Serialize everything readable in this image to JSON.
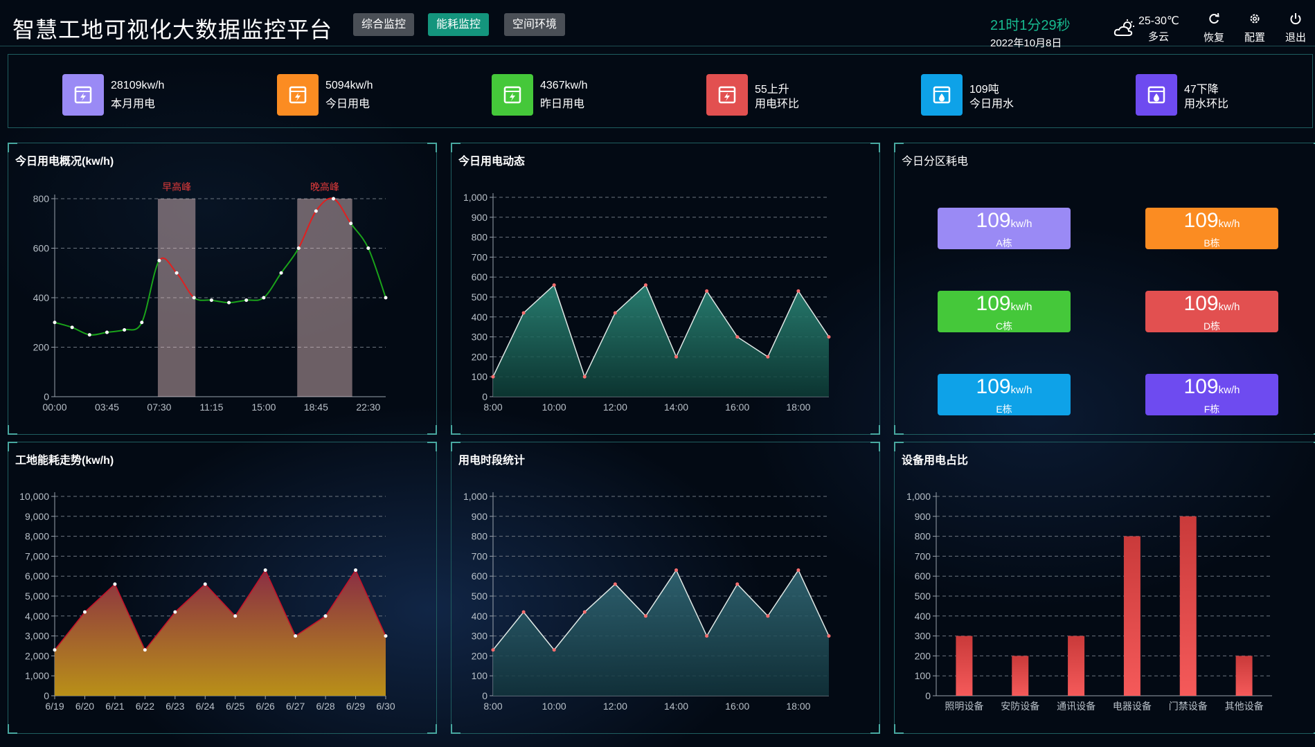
{
  "header": {
    "title": "智慧工地可视化大数据监控平台",
    "tabs": [
      {
        "label": "综合监控",
        "active": false
      },
      {
        "label": "能耗监控",
        "active": true
      },
      {
        "label": "空间环境",
        "active": false
      }
    ],
    "time": "21时1分29秒",
    "date": "2022年10月8日",
    "weather_temp": "25-30℃",
    "weather_cond": "多云",
    "actions": {
      "restore": "恢复",
      "settings": "配置",
      "logout": "退出"
    }
  },
  "stats": [
    {
      "value": "28109kw/h",
      "label": "本月用电",
      "color": "#9a8af5",
      "icon": "electric-meter-icon"
    },
    {
      "value": "5094kw/h",
      "label": "今日用电",
      "color": "#fb8c22",
      "icon": "electric-meter-icon"
    },
    {
      "value": "4367kw/h",
      "label": "昨日用电",
      "color": "#45c83a",
      "icon": "electric-meter-icon"
    },
    {
      "value": "55上升",
      "label": "用电环比",
      "color": "#e25050",
      "icon": "electric-meter-icon"
    },
    {
      "value": "109吨",
      "label": "今日用水",
      "color": "#0ea2e8",
      "icon": "water-meter-icon"
    },
    {
      "value": "47下降",
      "label": "用水环比",
      "color": "#6e4bf0",
      "icon": "water-meter-icon"
    }
  ],
  "panels": {
    "p1": "今日用电概况(kw/h)",
    "p2": "今日用电动态",
    "p3": "今日分区耗电",
    "p4": "工地能耗走势(kw/h)",
    "p5": "用电时段统计",
    "p6": "设备用电占比"
  },
  "zones": [
    {
      "value": "109",
      "unit": "kw/h",
      "name": "A栋",
      "color": "#9a8af5"
    },
    {
      "value": "109",
      "unit": "kw/h",
      "name": "B栋",
      "color": "#fb8c22"
    },
    {
      "value": "109",
      "unit": "kw/h",
      "name": "C栋",
      "color": "#45c83a"
    },
    {
      "value": "109",
      "unit": "kw/h",
      "name": "D栋",
      "color": "#e25050"
    },
    {
      "value": "109",
      "unit": "kw/h",
      "name": "E栋",
      "color": "#0ea2e8"
    },
    {
      "value": "109",
      "unit": "kw/h",
      "name": "F栋",
      "color": "#6e4bf0"
    }
  ],
  "chart_data": [
    {
      "type": "line",
      "title": "今日用电概况(kw/h)",
      "x": [
        0,
        1,
        2,
        3,
        4,
        5,
        6,
        7,
        8,
        9,
        10,
        11,
        12,
        13,
        14,
        15,
        16,
        17,
        18,
        19
      ],
      "y": [
        300,
        280,
        250,
        260,
        270,
        300,
        550,
        500,
        400,
        390,
        380,
        390,
        400,
        500,
        600,
        750,
        800,
        700,
        600,
        400
      ],
      "xticks": [
        "00:00",
        "03:45",
        "07:30",
        "11:15",
        "15:00",
        "18:45",
        "22:30"
      ],
      "ylim": [
        0,
        800
      ],
      "yticks": [
        0,
        200,
        400,
        600,
        800
      ],
      "bands": [
        {
          "label": "早高峰",
          "from": 6,
          "to": 8
        },
        {
          "label": "晚高峰",
          "from": 14,
          "to": 17
        }
      ],
      "colors": {
        "normal": "#1aa31a",
        "peak": "#e02020",
        "band": "#ffd6d6"
      }
    },
    {
      "type": "area",
      "title": "今日用电动态",
      "y": [
        100,
        420,
        560,
        100,
        420,
        560,
        200,
        530,
        300,
        200,
        530,
        300
      ],
      "xticks": [
        "8:00",
        "10:00",
        "12:00",
        "14:00",
        "16:00",
        "18:00"
      ],
      "ylim": [
        0,
        1000
      ],
      "yticks": [
        0,
        100,
        200,
        300,
        400,
        500,
        600,
        700,
        800,
        900,
        1000
      ],
      "colors": {
        "line": "#dfe8e6",
        "fillTop": "#2e8f7e",
        "fillBottom": "#0d3b35",
        "point": "#ff7070"
      }
    },
    {
      "type": "area",
      "title": "工地能耗走势(kw/h)",
      "categories": [
        "6/19",
        "6/20",
        "6/21",
        "6/22",
        "6/23",
        "6/24",
        "6/25",
        "6/26",
        "6/27",
        "6/28",
        "6/29",
        "6/30"
      ],
      "y": [
        2300,
        4200,
        5600,
        2300,
        4200,
        5600,
        4000,
        6300,
        3000,
        4000,
        6300,
        3000
      ],
      "ylim": [
        0,
        10000
      ],
      "yticks": [
        0,
        1000,
        2000,
        3000,
        4000,
        5000,
        6000,
        7000,
        8000,
        9000,
        10000
      ],
      "colors": {
        "line": "#c4102a",
        "fillTop": "#8a2e44",
        "fillBottom": "#b99018",
        "point": "#ffffff"
      }
    },
    {
      "type": "area",
      "title": "用电时段统计",
      "y": [
        230,
        420,
        230,
        420,
        560,
        400,
        630,
        300,
        560,
        400,
        630,
        300
      ],
      "xticks": [
        "8:00",
        "10:00",
        "12:00",
        "14:00",
        "16:00",
        "18:00"
      ],
      "ylim": [
        0,
        1000
      ],
      "yticks": [
        0,
        100,
        200,
        300,
        400,
        500,
        600,
        700,
        800,
        900,
        1000
      ],
      "colors": {
        "line": "#dfe8e6",
        "fillTop": "#346d7a",
        "fillBottom": "#12343c",
        "point": "#ff7070"
      }
    },
    {
      "type": "bar",
      "title": "设备用电占比",
      "categories": [
        "照明设备",
        "安防设备",
        "通讯设备",
        "电器设备",
        "门禁设备",
        "其他设备"
      ],
      "values": [
        300,
        200,
        300,
        800,
        900,
        200
      ],
      "ylim": [
        0,
        1000
      ],
      "yticks": [
        0,
        100,
        200,
        300,
        400,
        500,
        600,
        700,
        800,
        900,
        1000
      ],
      "colors": {
        "top": "#c93a3a",
        "bottom": "#f55a5a"
      }
    }
  ]
}
